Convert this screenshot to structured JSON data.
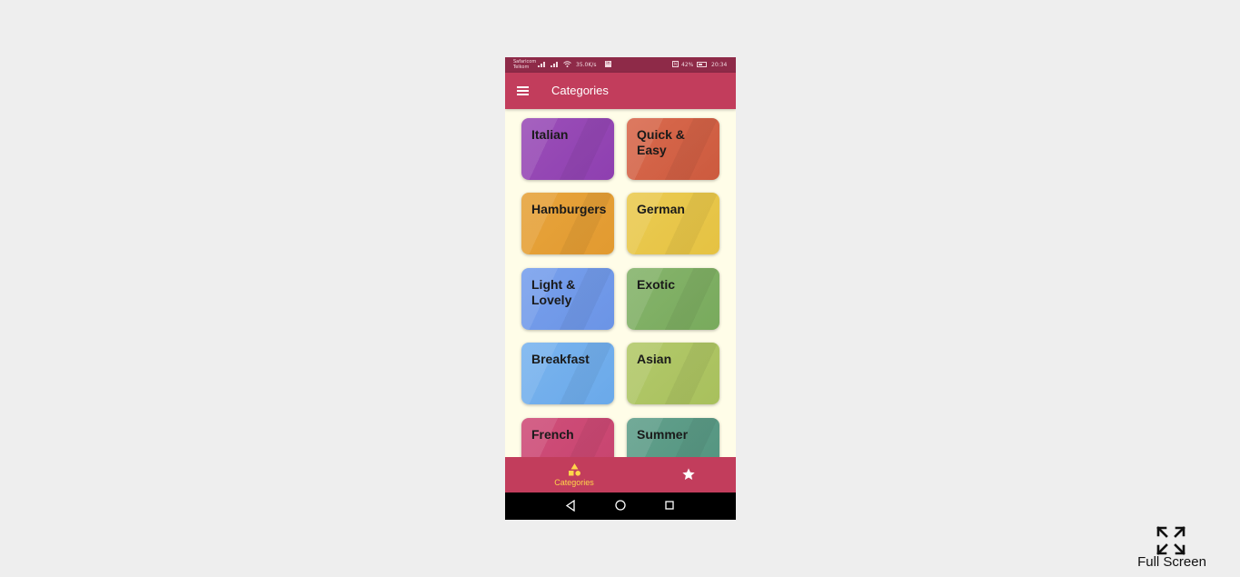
{
  "status_bar": {
    "carrier_line1": "Safaricom",
    "carrier_line2": "Telkom",
    "speed": "35.0K/s",
    "linkedin": "in",
    "nfc": "N",
    "battery": "42%",
    "time": "20:34"
  },
  "app_bar": {
    "menu_icon": "hamburger-menu-icon",
    "title": "Categories"
  },
  "categories": [
    {
      "label": "Italian",
      "color": "#9b4fb8",
      "color2": "#8e3fb0"
    },
    {
      "label": "Quick & Easy",
      "color": "#d96a4e",
      "color2": "#cc5a3e"
    },
    {
      "label": "Hamburgers",
      "color": "#e7a43c",
      "color2": "#e29a30"
    },
    {
      "label": "German",
      "color": "#ebcb52",
      "color2": "#e5c242"
    },
    {
      "label": "Light & Lovely",
      "color": "#78a0ec",
      "color2": "#6b94e6"
    },
    {
      "label": "Exotic",
      "color": "#86b46c",
      "color2": "#78aa5c"
    },
    {
      "label": "Breakfast",
      "color": "#7ab4ee",
      "color2": "#6aa9ea"
    },
    {
      "label": "Asian",
      "color": "#b3c96b",
      "color2": "#a8c05c"
    },
    {
      "label": "French",
      "color": "#cf4f7a",
      "color2": "#c7436e"
    },
    {
      "label": "Summer",
      "color": "#62a08c",
      "color2": "#53947f"
    }
  ],
  "bottom_nav": {
    "categories_label": "Categories",
    "categories_icon": "category-shapes-icon",
    "favorites_icon": "star-icon",
    "active_color": "#ffd54a"
  },
  "system_nav": {
    "back_icon": "back-triangle-icon",
    "home_icon": "home-circle-icon",
    "recent_icon": "recent-square-icon"
  },
  "fullscreen": {
    "label": "Full Screen",
    "icon": "expand-arrows-icon"
  }
}
